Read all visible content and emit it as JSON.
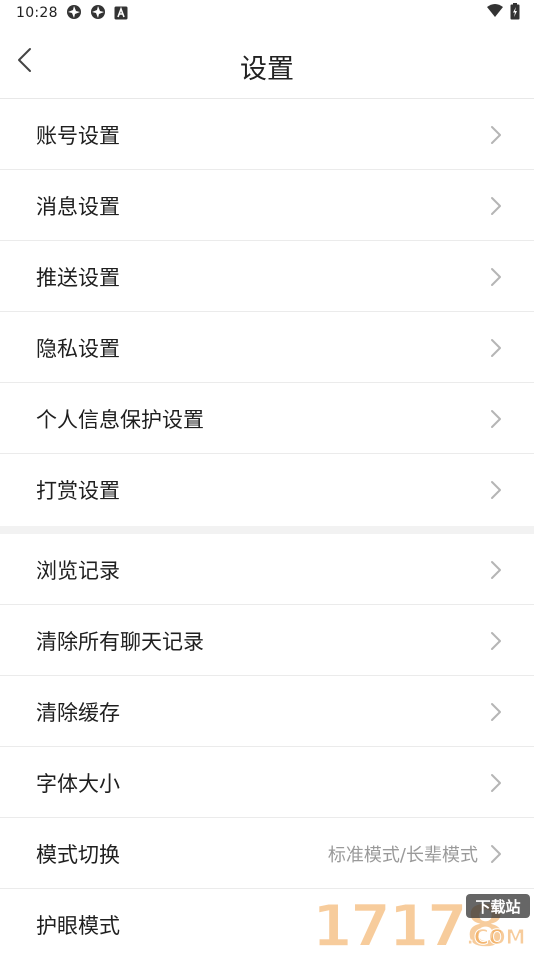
{
  "status_bar": {
    "time": "10:28",
    "icons_left": [
      "aperture-icon",
      "aperture-icon",
      "a-icon"
    ],
    "icons_right": [
      "wifi-icon",
      "battery-icon"
    ]
  },
  "header": {
    "title": "设置",
    "back_icon": "chevron-left-icon"
  },
  "settings": {
    "group1": [
      {
        "label": "账号设置"
      },
      {
        "label": "消息设置"
      },
      {
        "label": "推送设置"
      },
      {
        "label": "隐私设置"
      },
      {
        "label": "个人信息保护设置"
      },
      {
        "label": "打赏设置"
      }
    ],
    "group2": [
      {
        "label": "浏览记录",
        "value": ""
      },
      {
        "label": "清除所有聊天记录",
        "value": ""
      },
      {
        "label": "清除缓存",
        "value": ""
      },
      {
        "label": "字体大小",
        "value": ""
      },
      {
        "label": "模式切换",
        "value": "标准模式/长辈模式"
      },
      {
        "label": "护眼模式",
        "value": ""
      }
    ]
  },
  "watermark": {
    "text": "17178",
    "suffix": ".COM",
    "tag": "下载站"
  },
  "colors": {
    "chevron": "#b5b5b5",
    "divider": "#ebebeb",
    "section_gap": "#f2f2f2",
    "value_text": "#9a9a9a",
    "watermark_orange": "#f0a24a"
  }
}
